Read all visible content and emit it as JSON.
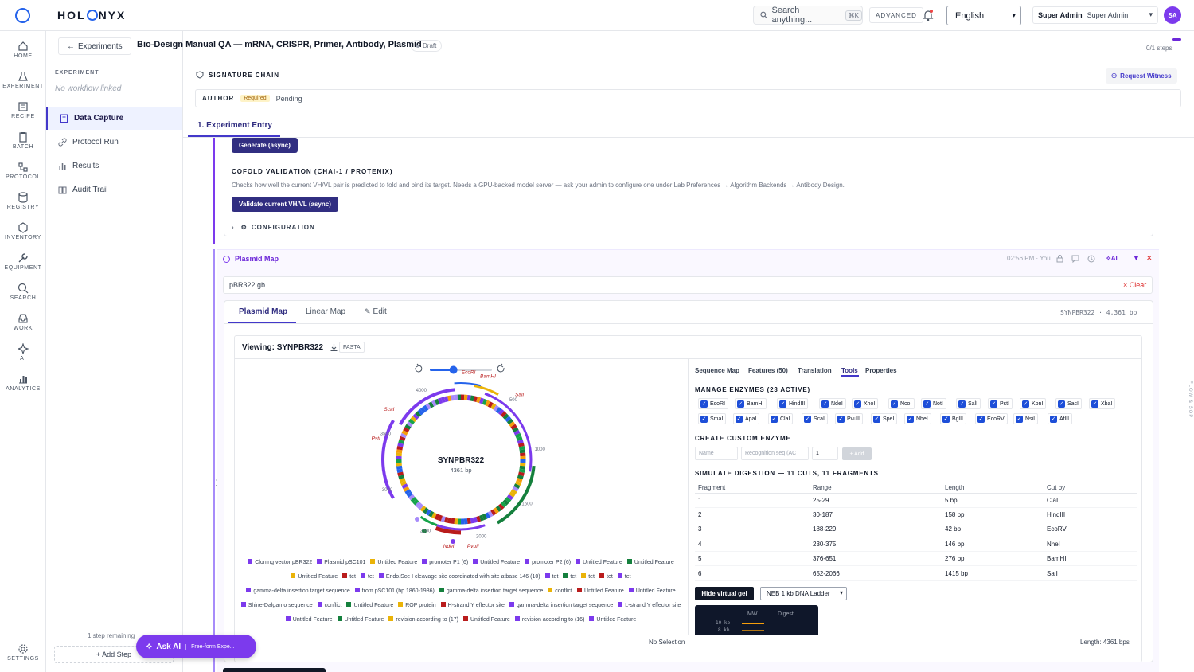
{
  "topbar": {
    "brand_left": "HOL",
    "brand_right": "NYX",
    "search_placeholder": "Search anything...",
    "search_shortcut": "⌘K",
    "advanced_label": "ADVANCED",
    "language": "English",
    "user_role_bold": "Super Admin",
    "user_role": "Super Admin",
    "avatar_initials": "SA"
  },
  "rail": {
    "items": [
      "HOME",
      "EXPERIMENT",
      "RECIPE",
      "BATCH",
      "PROTOCOL",
      "REGISTRY",
      "INVENTORY",
      "EQUIPMENT",
      "SEARCH",
      "WORK",
      "AI",
      "ANALYTICS"
    ],
    "settings": "SETTINGS"
  },
  "sidebar": {
    "back_label": "Experiments",
    "section_label": "EXPERIMENT",
    "section_sub": "No workflow linked",
    "nav": [
      "Data Capture",
      "Protocol Run",
      "Results",
      "Audit Trail"
    ],
    "steps_remaining": "1 step remaining",
    "add_step": "+ Add Step"
  },
  "header": {
    "title": "Bio-Design Manual QA — mRNA, CRISPR, Primer, Antibody, Plasmid",
    "status": "Draft",
    "steps": "0/1 steps",
    "steps_fraction": 0.0
  },
  "signature": {
    "title": "SIGNATURE CHAIN",
    "request_witness": "Request Witness",
    "role": "AUTHOR",
    "required": "Required",
    "state": "Pending"
  },
  "entry_tab": "1. Experiment Entry",
  "cofold": {
    "generate_btn": "Generate (async)",
    "title": "COFOLD VALIDATION (CHAI-1 / PROTENIX)",
    "description": "Checks how well the current VH/VL pair is predicted to fold and bind its target. Needs a GPU-backed model server — ask your admin to configure one under Lab Preferences → Algorithm Backends → Antibody Design.",
    "validate_btn": "Validate current VH/VL (async)",
    "config_label": "CONFIGURATION"
  },
  "plasmid": {
    "title": "Plasmid Map",
    "meta": "02:56 PM · You",
    "ai_label": "AI",
    "file_name": "pBR322.gb",
    "clear_label": "× Clear",
    "view_tabs": [
      "Plasmid Map",
      "Linear Map",
      "Edit"
    ],
    "seq_id": "SYNPBR322 · 4,361 bp",
    "viewing": "Viewing: SYNPBR322",
    "fasta": "FASTA",
    "map_name": "SYNPBR322",
    "map_len": "4361 bp",
    "zoom_fraction": 0.38,
    "tick_labels": [
      "500",
      "1000",
      "1500",
      "2000",
      "2500",
      "3000",
      "3500",
      "4000"
    ],
    "site_labels": [
      "EcoRI",
      "BamHI",
      "SalI",
      "ScaI",
      "PstI",
      "NdeI",
      "PvuII"
    ],
    "status_left": "No Selection",
    "status_right": "Length: 4361 bps"
  },
  "legend": [
    {
      "name": "Cloning vector pBR322",
      "color": "#7c3aed"
    },
    {
      "name": "Plasmid pSC101",
      "color": "#7c3aed"
    },
    {
      "name": "Untitled Feature",
      "color": "#eab308"
    },
    {
      "name": "promoter P1 (6)",
      "color": "#7c3aed"
    },
    {
      "name": "Untitled Feature",
      "color": "#7c3aed"
    },
    {
      "name": "promoter P2 (6)",
      "color": "#7c3aed"
    },
    {
      "name": "Untitled Feature",
      "color": "#7c3aed"
    },
    {
      "name": "Untitled Feature",
      "color": "#15803d"
    },
    {
      "name": "Untitled Feature",
      "color": "#eab308"
    },
    {
      "name": "tet",
      "color": "#b91c1c"
    },
    {
      "name": "tet",
      "color": "#7c3aed"
    },
    {
      "name": "Endo.Sce I cleavage site coordinated with site atbase 146 (10)",
      "color": "#7c3aed"
    },
    {
      "name": "tet",
      "color": "#7c3aed"
    },
    {
      "name": "tet",
      "color": "#15803d"
    },
    {
      "name": "tet",
      "color": "#eab308"
    },
    {
      "name": "tet",
      "color": "#b91c1c"
    },
    {
      "name": "tet",
      "color": "#7c3aed"
    },
    {
      "name": "gamma-delta insertion target sequence",
      "color": "#7c3aed"
    },
    {
      "name": "from pSC101 (bp 1860-1986)",
      "color": "#7c3aed"
    },
    {
      "name": "gamma-delta insertion target sequence",
      "color": "#15803d"
    },
    {
      "name": "conflict",
      "color": "#eab308"
    },
    {
      "name": "Untitled Feature",
      "color": "#b91c1c"
    },
    {
      "name": "Untitled Feature",
      "color": "#7c3aed"
    },
    {
      "name": "Shine-Dalgarno sequence",
      "color": "#7c3aed"
    },
    {
      "name": "conflict",
      "color": "#7c3aed"
    },
    {
      "name": "Untitled Feature",
      "color": "#15803d"
    },
    {
      "name": "ROP protein",
      "color": "#eab308"
    },
    {
      "name": "H-strand Y effector site",
      "color": "#b91c1c"
    },
    {
      "name": "gamma-delta insertion target sequence",
      "color": "#7c3aed"
    },
    {
      "name": "L-strand Y effector site",
      "color": "#7c3aed"
    },
    {
      "name": "Untitled Feature",
      "color": "#7c3aed"
    },
    {
      "name": "Untitled Feature",
      "color": "#15803d"
    },
    {
      "name": "revision according to (17)",
      "color": "#eab308"
    },
    {
      "name": "Untitled Feature",
      "color": "#b91c1c"
    },
    {
      "name": "revision according to (16)",
      "color": "#7c3aed"
    },
    {
      "name": "Untitled Feature",
      "color": "#7c3aed"
    }
  ],
  "tools": {
    "tabs": [
      "Sequence Map",
      "Features (50)",
      "Translation",
      "Tools",
      "Properties"
    ],
    "enzymes_title": "MANAGE ENZYMES (23 ACTIVE)",
    "enzymes": [
      "EcoRI",
      "BamHI",
      "HindIII",
      "NdeI",
      "XhoI",
      "NcoI",
      "NotI",
      "SalI",
      "PstI",
      "KpnI",
      "SacI",
      "XbaI",
      "SmaI",
      "ApaI",
      "ClaI",
      "ScaI",
      "PvuII",
      "SpeI",
      "NheI",
      "BglII",
      "EcoRV",
      "NsiI",
      "AflII"
    ],
    "custom_title": "CREATE CUSTOM ENZYME",
    "name_placeholder": "Name",
    "seq_placeholder": "Recognition seq (AC",
    "cut_value": "1",
    "add_label": "+ Add",
    "digest_title": "SIMULATE DIGESTION — 11 CUTS, 11 FRAGMENTS",
    "columns": [
      "Fragment",
      "Range",
      "Length",
      "Cut by"
    ],
    "rows": [
      [
        "1",
        "25-29",
        "5 bp",
        "ClaI"
      ],
      [
        "2",
        "30-187",
        "158 bp",
        "HindIII"
      ],
      [
        "3",
        "188-229",
        "42 bp",
        "EcoRV"
      ],
      [
        "4",
        "230-375",
        "146 bp",
        "NheI"
      ],
      [
        "5",
        "376-651",
        "276 bp",
        "BamHI"
      ],
      [
        "6",
        "652-2066",
        "1415 bp",
        "SalI"
      ]
    ],
    "hide_gel": "Hide virtual gel",
    "ladder": "NEB 1 kb DNA Ladder",
    "gel_mw": "MW",
    "gel_digest": "Digest",
    "gel_labels": [
      "10 kb",
      "8 kb"
    ]
  },
  "ask_ai": {
    "label": "Ask AI",
    "sub": "Free-form Expe..."
  },
  "flow_sop": "FLOW & SOP"
}
